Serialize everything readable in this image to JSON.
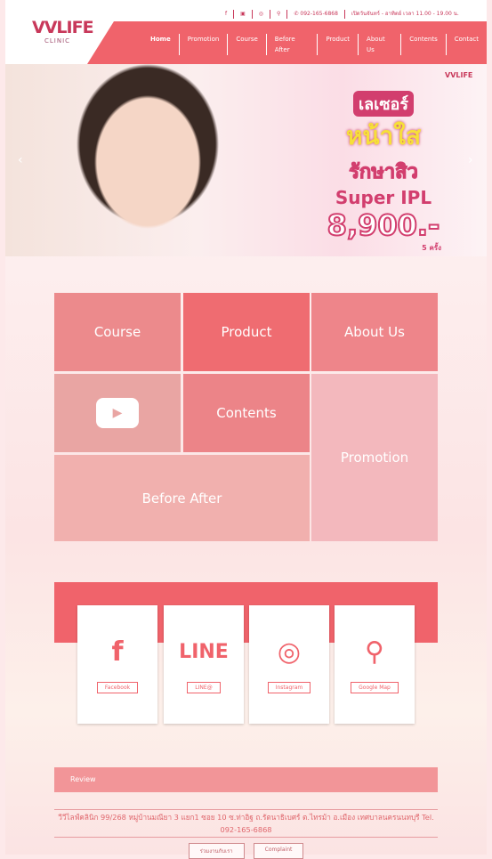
{
  "brand": {
    "logo": "VVLIFE",
    "logo_sub": "CLINIC"
  },
  "topbar": {
    "phone": "092-165-6868",
    "hours": "เปิดวันจันทร์ - อาทิตย์ เวลา 11.00 - 19.00 น.",
    "icons": [
      "facebook-icon",
      "line-icon",
      "instagram-icon",
      "map-pin-icon",
      "phone-icon"
    ]
  },
  "nav": [
    "Home",
    "Promotion",
    "Course",
    "Before After",
    "Product",
    "About Us",
    "Contents",
    "Contact"
  ],
  "hero": {
    "line1": "เลเซอร์",
    "line2": "หน้าใส",
    "line3": "รักษาสิว",
    "line4": "Super IPL",
    "price": "8,900.-",
    "note": "5 ครั้ง",
    "logo": "VVLIFE"
  },
  "tiles": {
    "course": "Course",
    "product": "Product",
    "about": "About Us",
    "contents": "Contents",
    "promotion": "Promotion",
    "before_after": "Before After"
  },
  "social": [
    {
      "icon": "f",
      "label": "Facebook"
    },
    {
      "icon": "LINE",
      "label": "LINE@"
    },
    {
      "icon": "◎",
      "label": "Instagram"
    },
    {
      "icon": "⚲",
      "label": "Google Map"
    }
  ],
  "review": "Review",
  "address": "วีวีไลฟ์คลินิก 99/268 หมู่บ้านมณียา 3 แยก1 ซอย 10 ซ.ท่าอิฐ ถ.รัตนาธิเบศร์ ต.ไทรม้า อ.เมือง เทศบาลนครนนทบุรี Tel. 092-165-6868",
  "buttons": {
    "join": "ร่วมงานกับเรา",
    "complaint": "Complaint"
  },
  "colors": {
    "accent": "#f0636b",
    "brand": "#c8385a"
  }
}
